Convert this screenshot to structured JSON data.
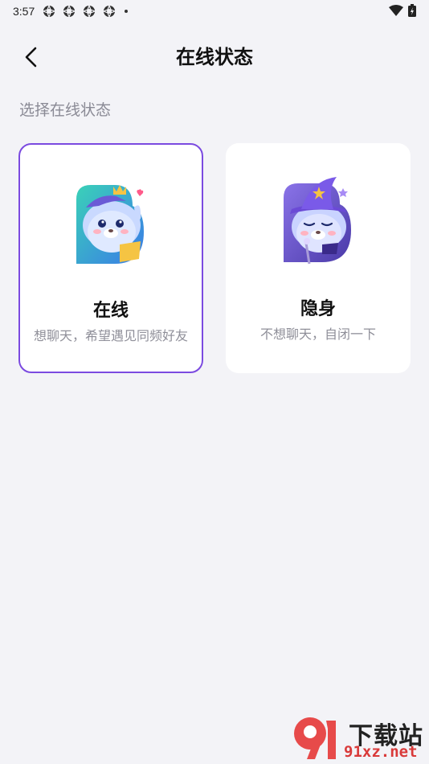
{
  "status_bar": {
    "time": "3:57",
    "app_icons": [
      "openai-app-icon",
      "openai-app-icon",
      "openai-app-icon",
      "openai-app-icon"
    ],
    "wifi_icon": "wifi-icon",
    "battery_icon": "battery-charging-icon"
  },
  "header": {
    "back_icon": "chevron-left-icon",
    "title": "在线状态"
  },
  "section": {
    "label": "选择在线状态"
  },
  "options": [
    {
      "title": "在线",
      "description": "想聊天，希望遇见同频好友",
      "selected": true,
      "mascot": "seal-mascot-crown"
    },
    {
      "title": "隐身",
      "description": "不想聊天，自闭一下",
      "selected": false,
      "mascot": "seal-mascot-wizard"
    }
  ],
  "colors": {
    "background": "#f3f3f7",
    "card": "#ffffff",
    "selected_border": "#7b4ae0",
    "secondary_text": "#8f8f99"
  },
  "watermark": {
    "top": "下载站",
    "bottom": "91xz.net"
  }
}
